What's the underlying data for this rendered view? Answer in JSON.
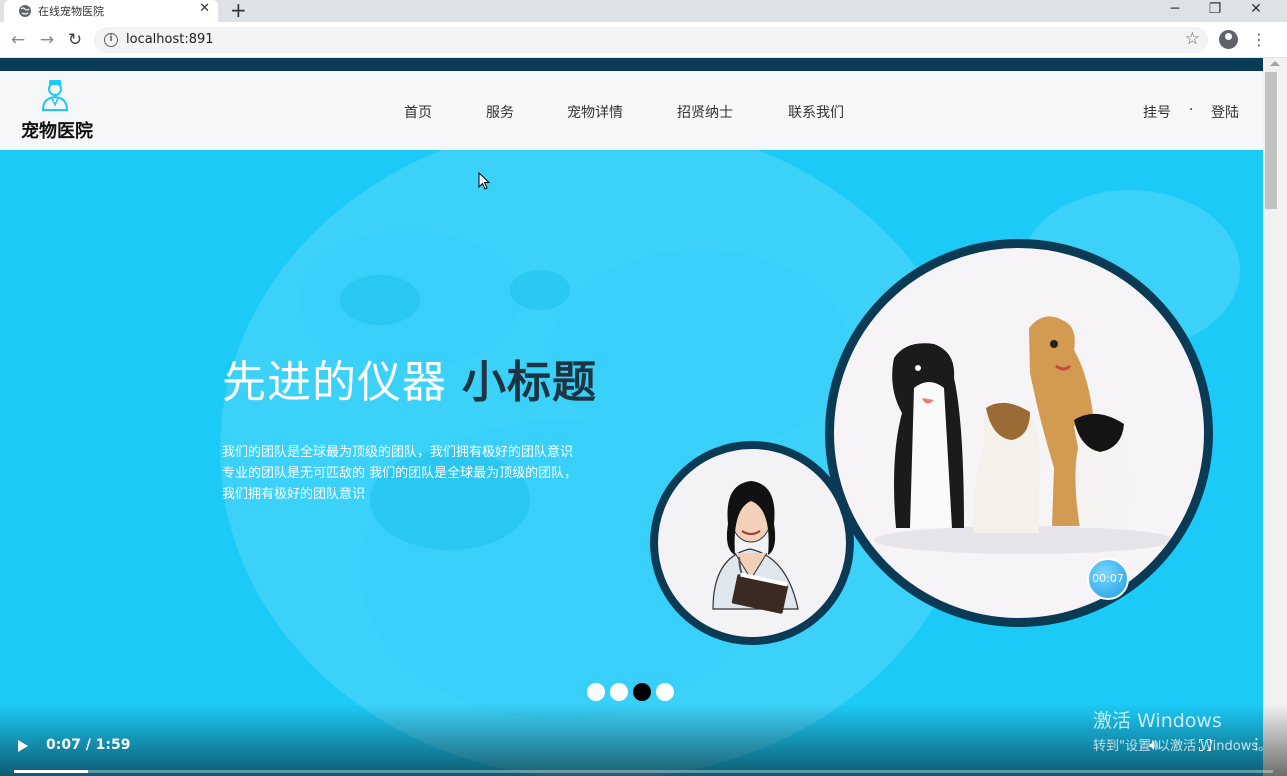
{
  "browser": {
    "tab_title": "在线宠物医院",
    "url": "localhost:891"
  },
  "site": {
    "logo_text": "宠物医院",
    "nav": [
      {
        "label": "首页"
      },
      {
        "label": "服务"
      },
      {
        "label": "宠物详情"
      },
      {
        "label": "招贤纳士"
      },
      {
        "label": "联系我们"
      }
    ],
    "register_label": "挂号",
    "separator": "·",
    "login_label": "登陆"
  },
  "hero": {
    "title_light": "先进的仪器",
    "title_bold": "小标题",
    "desc_lines": [
      "我们的团队是全球最为顶级的团队，我们拥有极好的团队意识",
      "专业的团队是无可匹敌的 我们的团队是全球最为顶级的团队，",
      "我们拥有极好的团队意识"
    ],
    "slide_count": 4,
    "active_slide": 3,
    "timer_badge": "00:07"
  },
  "video": {
    "time": "0:07 / 1:59",
    "progress_fraction": 0.059
  },
  "watermark": {
    "line1": "激活 Windows",
    "line2": "转到\"设置\"以激活 Windows。"
  },
  "colors": {
    "hero_bg": "#1ccaf7",
    "dark_navy": "#0b3a55",
    "header_bg": "#f5f7f8"
  }
}
